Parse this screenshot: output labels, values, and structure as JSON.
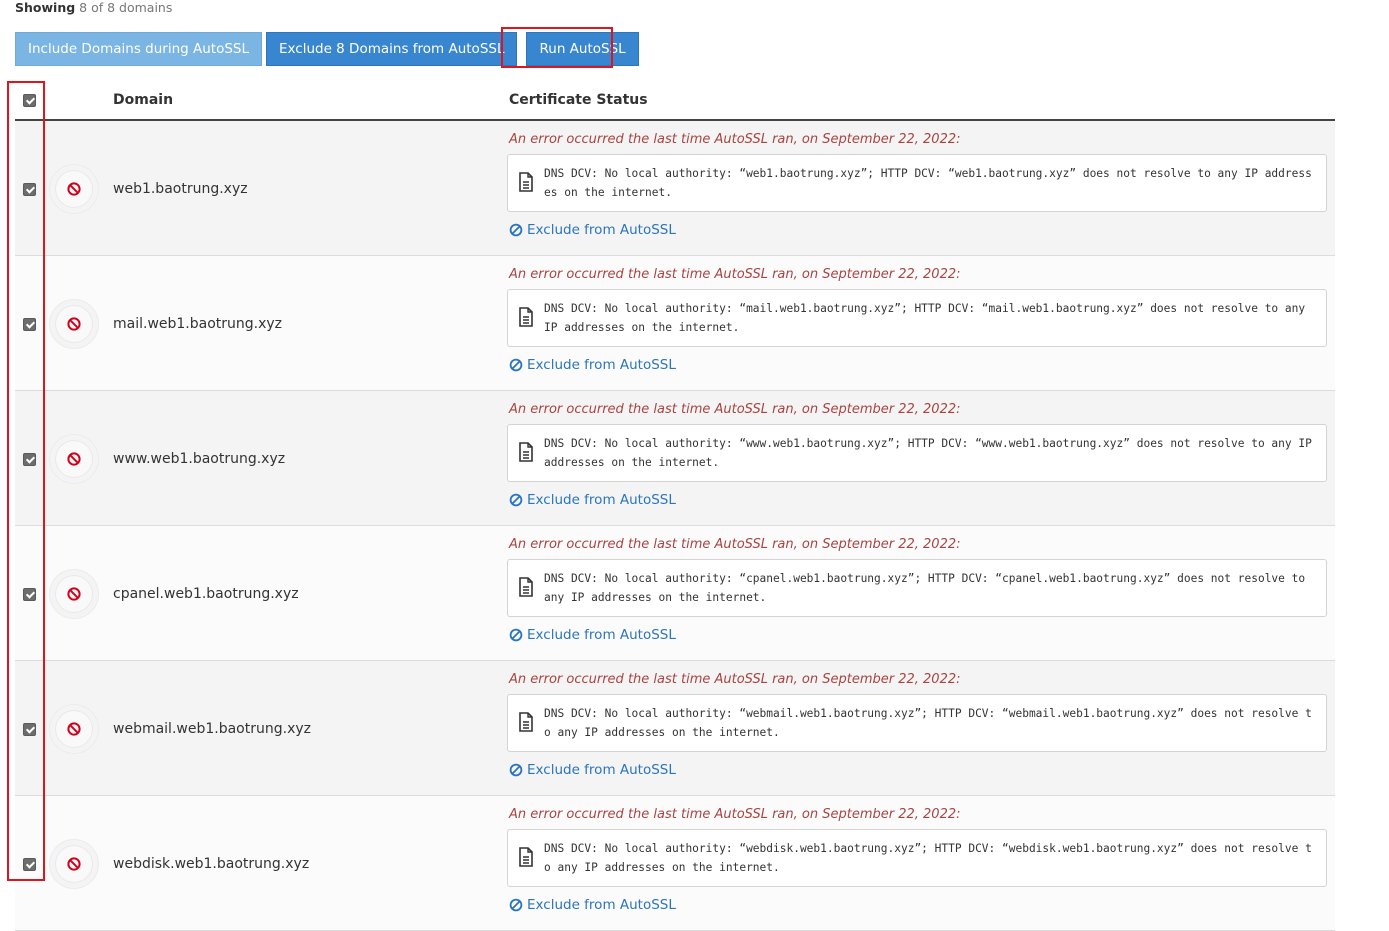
{
  "summary": {
    "bold": "Showing",
    "rest": "8 of 8 domains"
  },
  "toolbar": {
    "include_label": "Include Domains during AutoSSL",
    "exclude_label": "Exclude 8 Domains from AutoSSL",
    "run_label": "Run AutoSSL"
  },
  "table": {
    "headers": {
      "domain": "Domain",
      "status": "Certificate Status"
    },
    "error_heading": "An error occurred the last time AutoSSL ran, on September 22, 2022:",
    "exclude_link": "Exclude from AutoSSL",
    "rows": [
      {
        "domain": "web1.baotrung.xyz",
        "message": "DNS DCV: No local authority: “web1.baotrung.xyz”; HTTP DCV: “web1.baotrung.xyz” does not resolve to any IP addresses on the internet."
      },
      {
        "domain": "mail.web1.baotrung.xyz",
        "message": "DNS DCV: No local authority: “mail.web1.baotrung.xyz”; HTTP DCV: “mail.web1.baotrung.xyz” does not resolve to any IP addresses on the internet."
      },
      {
        "domain": "www.web1.baotrung.xyz",
        "message": "DNS DCV: No local authority: “www.web1.baotrung.xyz”; HTTP DCV: “www.web1.baotrung.xyz” does not resolve to any IP addresses on the internet."
      },
      {
        "domain": "cpanel.web1.baotrung.xyz",
        "message": "DNS DCV: No local authority: “cpanel.web1.baotrung.xyz”; HTTP DCV: “cpanel.web1.baotrung.xyz” does not resolve to any IP addresses on the internet."
      },
      {
        "domain": "webmail.web1.baotrung.xyz",
        "message": "DNS DCV: No local authority: “webmail.web1.baotrung.xyz”; HTTP DCV: “webmail.web1.baotrung.xyz” does not resolve to any IP addresses on the internet."
      },
      {
        "domain": "webdisk.web1.baotrung.xyz",
        "message": "DNS DCV: No local authority: “webdisk.web1.baotrung.xyz”; HTTP DCV: “webdisk.web1.baotrung.xyz” does not resolve to any IP addresses on the internet."
      }
    ]
  },
  "colors": {
    "accent": "#3886d0",
    "error": "#a94442",
    "link": "#2a75be",
    "highlight": "#e0141c"
  },
  "icons": {
    "status": "ban-icon",
    "message": "file-text-icon",
    "exclude": "ban-icon"
  }
}
